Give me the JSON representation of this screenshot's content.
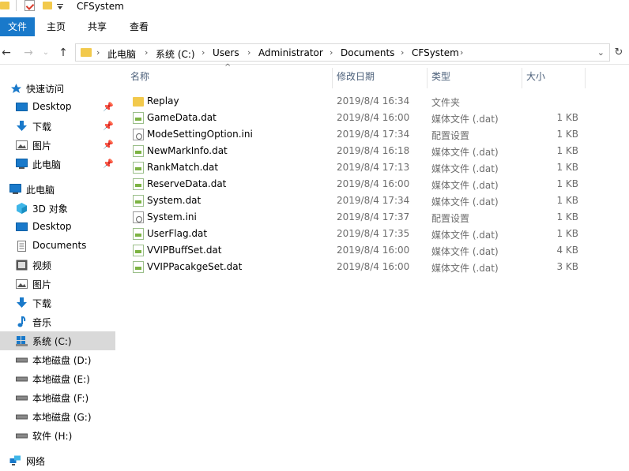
{
  "window": {
    "title": "CFSystem"
  },
  "ribbon": {
    "tabs": [
      {
        "label": "文件",
        "active": true
      },
      {
        "label": "主页"
      },
      {
        "label": "共享"
      },
      {
        "label": "查看"
      }
    ]
  },
  "nav": {
    "back_glyph": "←",
    "forward_glyph": "→",
    "recent_glyph": "⌄",
    "up_glyph": "↑",
    "breadcrumb": [
      "此电脑",
      "系统 (C:)",
      "Users",
      "Administrator",
      "Documents",
      "CFSystem"
    ],
    "separator": "›",
    "dropdown_glyph": "⌄",
    "refresh_glyph": "↻"
  },
  "sidebar": {
    "pin_glyph": "📌",
    "quick_access": "快速访问",
    "quick_items": [
      "Desktop",
      "下载",
      "图片",
      "此电脑"
    ],
    "this_pc": "此电脑",
    "pc_items": [
      "3D 对象",
      "Desktop",
      "Documents",
      "视频",
      "图片",
      "下载",
      "音乐",
      "系统 (C:)",
      "本地磁盘 (D:)",
      "本地磁盘 (E:)",
      "本地磁盘 (F:)",
      "本地磁盘 (G:)",
      "软件 (H:)"
    ],
    "network": "网络"
  },
  "columns": {
    "name": "名称",
    "date": "修改日期",
    "type": "类型",
    "size": "大小",
    "sort_glyph": "^"
  },
  "files": [
    {
      "name": "Replay",
      "date": "2019/8/4 16:34",
      "type": "文件夹",
      "size": "",
      "icon": "folder-icon"
    },
    {
      "name": "GameData.dat",
      "date": "2019/8/4 16:00",
      "type": "媒体文件 (.dat)",
      "size": "1 KB",
      "icon": "dat-file-icon"
    },
    {
      "name": "ModeSettingOption.ini",
      "date": "2019/8/4 17:34",
      "type": "配置设置",
      "size": "1 KB",
      "icon": "ini-file-icon"
    },
    {
      "name": "NewMarkInfo.dat",
      "date": "2019/8/4 16:18",
      "type": "媒体文件 (.dat)",
      "size": "1 KB",
      "icon": "dat-file-icon"
    },
    {
      "name": "RankMatch.dat",
      "date": "2019/8/4 17:13",
      "type": "媒体文件 (.dat)",
      "size": "1 KB",
      "icon": "dat-file-icon"
    },
    {
      "name": "ReserveData.dat",
      "date": "2019/8/4 16:00",
      "type": "媒体文件 (.dat)",
      "size": "1 KB",
      "icon": "dat-file-icon"
    },
    {
      "name": "System.dat",
      "date": "2019/8/4 17:34",
      "type": "媒体文件 (.dat)",
      "size": "1 KB",
      "icon": "dat-file-icon"
    },
    {
      "name": "System.ini",
      "date": "2019/8/4 17:37",
      "type": "配置设置",
      "size": "1 KB",
      "icon": "ini-file-icon"
    },
    {
      "name": "UserFlag.dat",
      "date": "2019/8/4 17:35",
      "type": "媒体文件 (.dat)",
      "size": "1 KB",
      "icon": "dat-file-icon"
    },
    {
      "name": "VVIPBuffSet.dat",
      "date": "2019/8/4 16:00",
      "type": "媒体文件 (.dat)",
      "size": "4 KB",
      "icon": "dat-file-icon"
    },
    {
      "name": "VVIPPacakgeSet.dat",
      "date": "2019/8/4 16:00",
      "type": "媒体文件 (.dat)",
      "size": "3 KB",
      "icon": "dat-file-icon"
    }
  ],
  "colors": {
    "accent": "#1979ca",
    "folder": "#f2c94c",
    "header_text": "#4c607a",
    "muted_text": "#6d6d6d",
    "selected_bg": "#d9d9d9"
  }
}
